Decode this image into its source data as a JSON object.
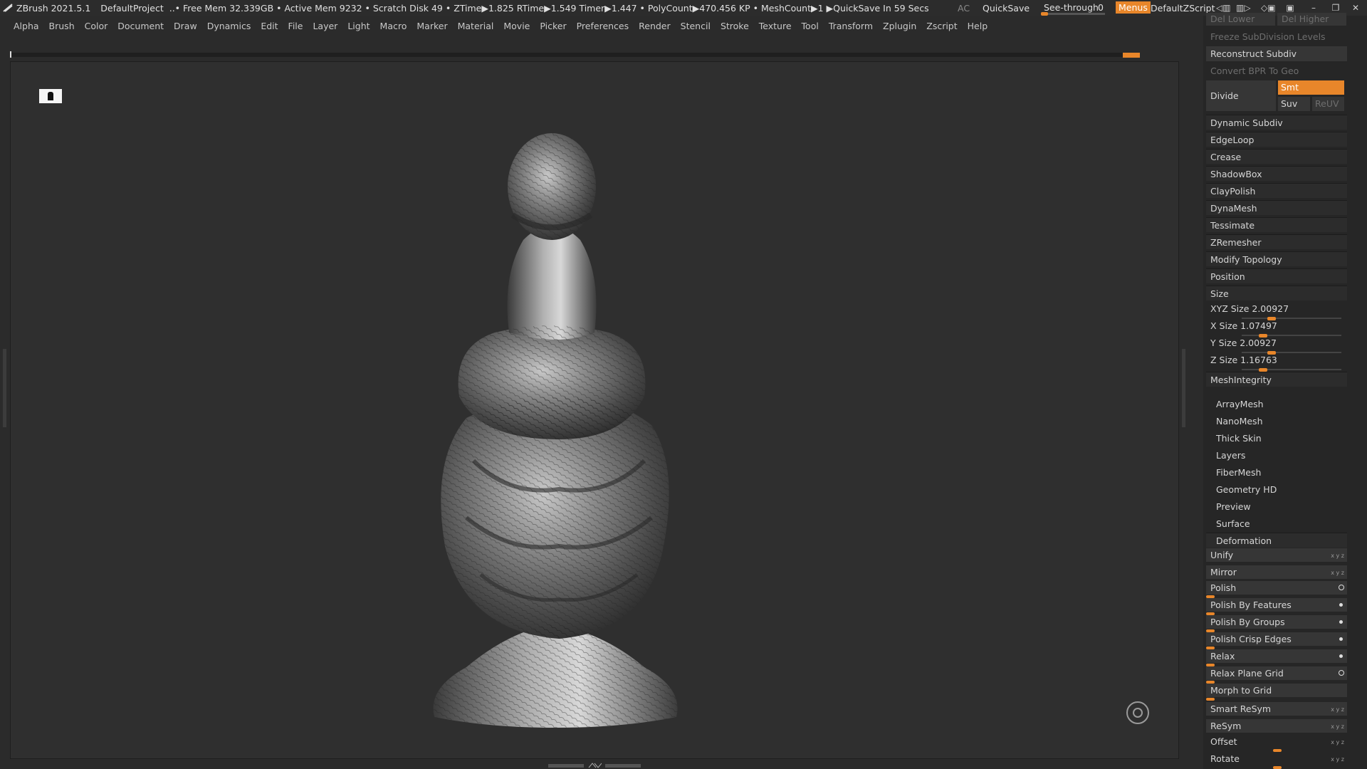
{
  "titlebar": {
    "app": "ZBrush 2021.5.1",
    "project": "DefaultProject",
    "stats": "..• Free Mem 32.339GB • Active Mem 9232 • Scratch Disk 49 •  ZTime▶1.825 RTime▶1.549 Timer▶1.447 • PolyCount▶470.456 KP  • MeshCount▶1  ▶QuickSave In 59 Secs",
    "ac": "AC",
    "quicksave": "QuickSave",
    "see_through_label": "See-through",
    "see_through_value": "0",
    "see_through_level": 0,
    "menus": "Menus",
    "default_zscript": "DefaultZScript",
    "accent_color": "#e8862a"
  },
  "menubar": [
    "Alpha",
    "Brush",
    "Color",
    "Document",
    "Draw",
    "Dynamics",
    "Edit",
    "File",
    "Layer",
    "Light",
    "Macro",
    "Marker",
    "Material",
    "Movie",
    "Picker",
    "Preferences",
    "Render",
    "Stencil",
    "Stroke",
    "Texture",
    "Tool",
    "Transform",
    "Zplugin",
    "Zscript",
    "Help"
  ],
  "panel": {
    "del_lower": "Del Lower",
    "del_higher": "Del Higher",
    "freeze_subdiv": "Freeze SubDivision Levels",
    "reconstruct": "Reconstruct Subdiv",
    "convert_bpr": "Convert BPR To Geo",
    "divide": "Divide",
    "smt": "Smt",
    "suv": "Suv",
    "reuv": "ReUV",
    "sections": [
      "Dynamic Subdiv",
      "EdgeLoop",
      "Crease",
      "ShadowBox",
      "ClayPolish",
      "DynaMesh",
      "Tessimate",
      "ZRemesher",
      "Modify Topology",
      "Position"
    ],
    "size_title": "Size",
    "xyz_size": "XYZ Size 2.00927",
    "x_size": "X Size 1.07497",
    "y_size": "Y Size 2.00927",
    "z_size": "Z Size 1.16763",
    "mesh_integrity": "MeshIntegrity",
    "subpalettes": [
      "ArrayMesh",
      "NanoMesh",
      "Thick Skin",
      "Layers",
      "FiberMesh",
      "Geometry HD",
      "Preview",
      "Surface"
    ],
    "deformation_title": "Deformation",
    "deform": {
      "unify": "Unify",
      "mirror": "Mirror",
      "polish": "Polish",
      "polish_features": "Polish By Features",
      "polish_groups": "Polish By Groups",
      "polish_crisp": "Polish Crisp Edges",
      "relax": "Relax",
      "relax_plane": "Relax Plane Grid",
      "morph_grid": "Morph to Grid",
      "smart_resym": "Smart ReSym",
      "resym": "ReSym",
      "offset": "Offset",
      "rotate": "Rotate"
    }
  }
}
